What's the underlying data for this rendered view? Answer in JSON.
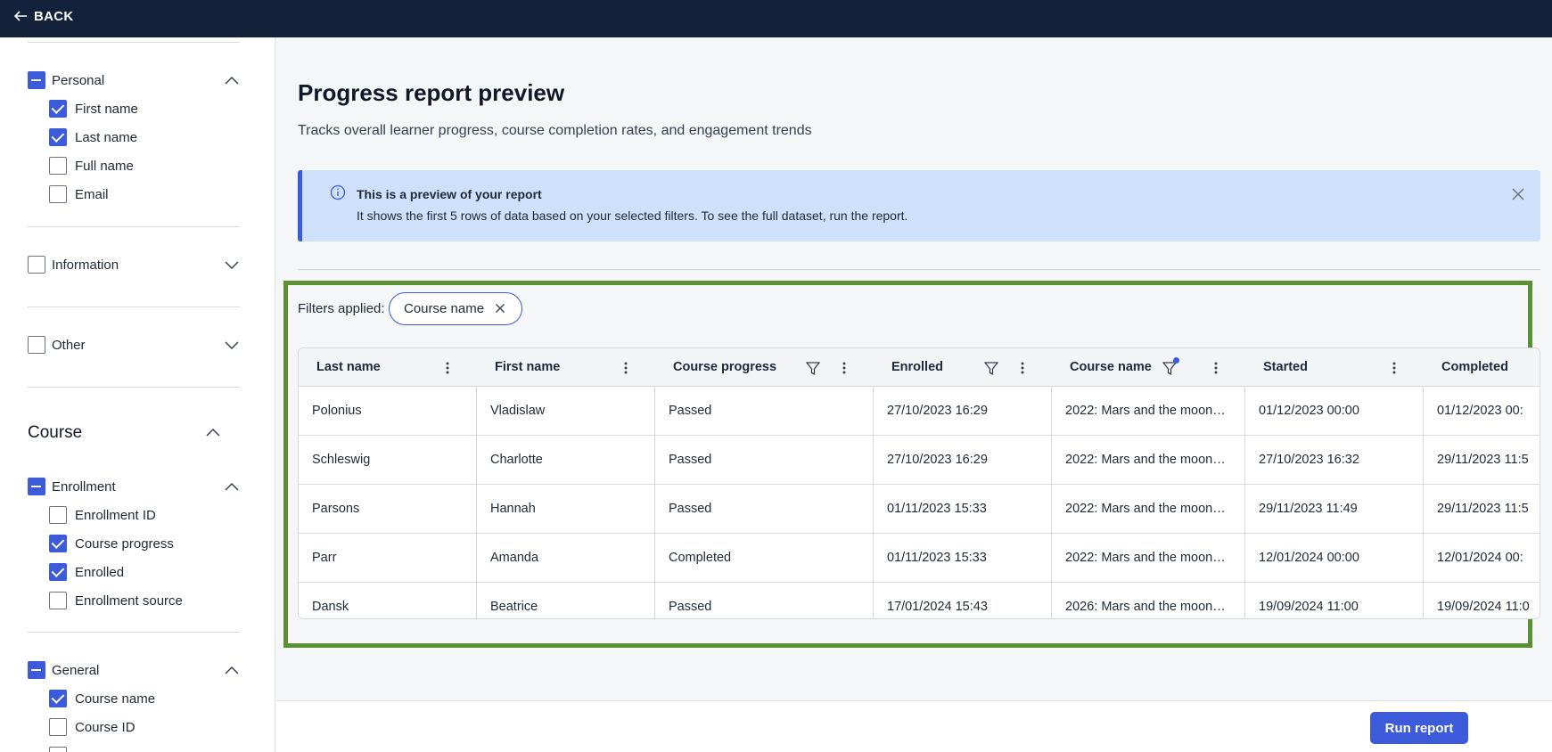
{
  "topbar": {
    "back_label": "BACK"
  },
  "sidebar": {
    "personal": {
      "label": "Personal",
      "items": [
        {
          "label": "First name",
          "checked": true
        },
        {
          "label": "Last name",
          "checked": true
        },
        {
          "label": "Full name",
          "checked": false
        },
        {
          "label": "Email",
          "checked": false
        }
      ]
    },
    "information": {
      "label": "Information"
    },
    "other": {
      "label": "Other"
    },
    "course_section": {
      "title": "Course"
    },
    "enrollment": {
      "label": "Enrollment",
      "items": [
        {
          "label": "Enrollment ID",
          "checked": false
        },
        {
          "label": "Course progress",
          "checked": true
        },
        {
          "label": "Enrolled",
          "checked": true
        },
        {
          "label": "Enrollment source",
          "checked": false
        }
      ]
    },
    "general": {
      "label": "General",
      "items": [
        {
          "label": "Course name",
          "checked": true
        },
        {
          "label": "Course ID",
          "checked": false
        }
      ]
    }
  },
  "main": {
    "title": "Progress report preview",
    "subtitle": "Tracks overall learner progress, course completion rates, and engagement trends",
    "banner": {
      "title": "This is a preview of your report",
      "text": "It shows the first 5 rows of data based on your selected filters. To see the full dataset, run the report."
    },
    "filters": {
      "label": "Filters applied:",
      "chip": "Course name"
    },
    "table": {
      "columns": [
        "Last name",
        "First name",
        "Course progress",
        "Enrolled",
        "Course name",
        "Started",
        "Completed"
      ],
      "rows": [
        [
          "Polonius",
          "Vladislaw",
          "Passed",
          "27/10/2023 16:29",
          "2022: Mars and the moon…",
          "01/12/2023 00:00",
          "01/12/2023 00:"
        ],
        [
          "Schleswig",
          "Charlotte",
          "Passed",
          "27/10/2023 16:29",
          "2022: Mars and the moon…",
          "27/10/2023 16:32",
          "29/11/2023 11:5"
        ],
        [
          "Parsons",
          "Hannah",
          "Passed",
          "01/11/2023 15:33",
          "2022: Mars and the moon…",
          "29/11/2023 11:49",
          "29/11/2023 11:5"
        ],
        [
          "Parr",
          "Amanda",
          "Completed",
          "01/11/2023 15:33",
          "2022: Mars and the moon…",
          "12/01/2024 00:00",
          "12/01/2024 00:"
        ],
        [
          "Dansk",
          "Beatrice",
          "Passed",
          "17/01/2024 15:43",
          "2026: Mars and the moon…",
          "19/09/2024 11:00",
          "19/09/2024 11:0"
        ]
      ]
    },
    "run_button": "Run report"
  },
  "colors": {
    "accent": "#3b5bdb",
    "topbar": "#14213a",
    "banner_bg": "#cfe0fb",
    "highlight": "#5a8f32"
  }
}
